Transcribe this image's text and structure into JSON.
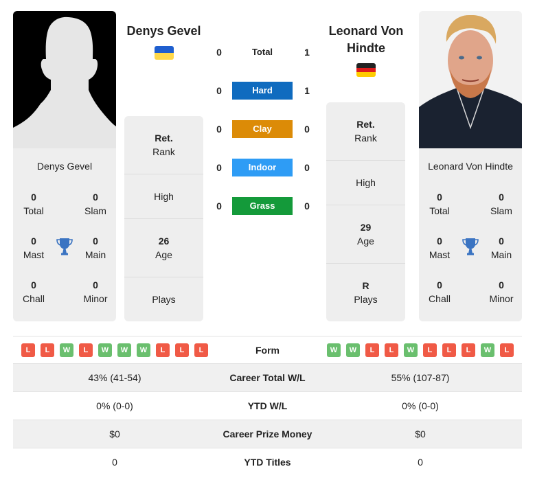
{
  "players": {
    "left": {
      "name": "Denys Gevel",
      "country": "Ukraine",
      "flag_colors": [
        "#1f5fcf",
        "#ffd84a"
      ],
      "photo": "silhouette-placeholder",
      "titles": {
        "total": "0",
        "total_label": "Total",
        "slam": "0",
        "slam_label": "Slam",
        "mast": "0",
        "mast_label": "Mast",
        "main": "0",
        "main_label": "Main",
        "chall": "0",
        "chall_label": "Chall",
        "minor": "0",
        "minor_label": "Minor"
      },
      "info": {
        "rank_value": "Ret.",
        "rank_label": "Rank",
        "high_value": "",
        "high_label": "High",
        "age_value": "26",
        "age_label": "Age",
        "plays_value": "",
        "plays_label": "Plays"
      }
    },
    "right": {
      "name": "Leonard Von Hindte",
      "name_line1": "Leonard Von",
      "name_line2": "Hindte",
      "country": "Germany",
      "flag_colors": [
        "#222222",
        "#dd1c1c",
        "#ffcc00"
      ],
      "photo": "player-photo",
      "titles": {
        "total": "0",
        "total_label": "Total",
        "slam": "0",
        "slam_label": "Slam",
        "mast": "0",
        "mast_label": "Mast",
        "main": "0",
        "main_label": "Main",
        "chall": "0",
        "chall_label": "Chall",
        "minor": "0",
        "minor_label": "Minor"
      },
      "info": {
        "rank_value": "Ret.",
        "rank_label": "Rank",
        "high_value": "",
        "high_label": "High",
        "age_value": "29",
        "age_label": "Age",
        "plays_value": "R",
        "plays_label": "Plays"
      }
    }
  },
  "h2h": {
    "rows": [
      {
        "label": "Total",
        "left": "0",
        "right": "1",
        "color": ""
      },
      {
        "label": "Hard",
        "left": "0",
        "right": "1",
        "color": "#0f6bbf"
      },
      {
        "label": "Clay",
        "left": "0",
        "right": "0",
        "color": "#dc8b07"
      },
      {
        "label": "Indoor",
        "left": "0",
        "right": "0",
        "color": "#2e9cf5"
      },
      {
        "label": "Grass",
        "left": "0",
        "right": "0",
        "color": "#149a3a"
      }
    ]
  },
  "colors": {
    "win": "#6abf6e",
    "loss": "#f05a46",
    "trophy": "#3b74c2"
  },
  "comparison": {
    "form": {
      "label": "Form",
      "left": [
        "L",
        "L",
        "W",
        "L",
        "W",
        "W",
        "W",
        "L",
        "L",
        "L"
      ],
      "right": [
        "W",
        "W",
        "L",
        "L",
        "W",
        "L",
        "L",
        "L",
        "W",
        "L"
      ]
    },
    "rows": [
      {
        "label": "Career Total W/L",
        "left": "43% (41-54)",
        "right": "55% (107-87)"
      },
      {
        "label": "YTD W/L",
        "left": "0% (0-0)",
        "right": "0% (0-0)"
      },
      {
        "label": "Career Prize Money",
        "left": "$0",
        "right": "$0"
      },
      {
        "label": "YTD Titles",
        "left": "0",
        "right": "0"
      }
    ]
  }
}
